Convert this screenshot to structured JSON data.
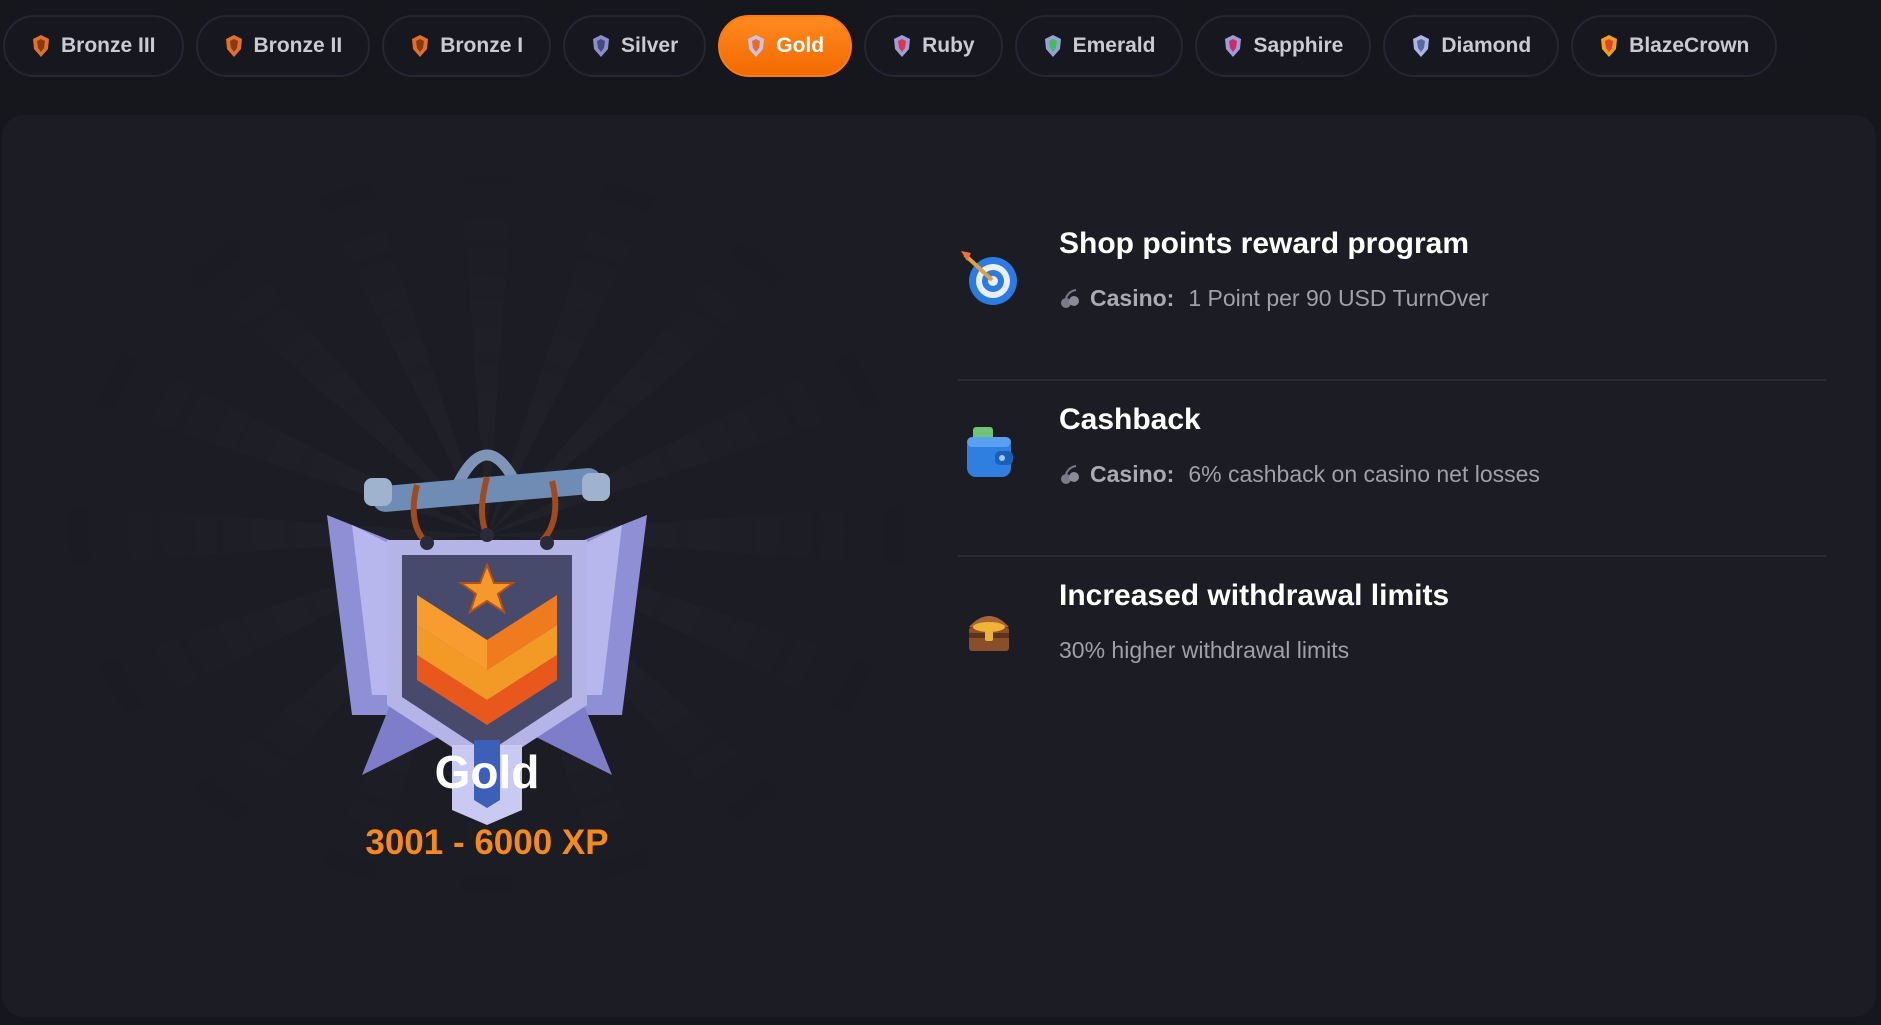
{
  "tiers": [
    {
      "label": "Bronze III",
      "color": "#e0702a",
      "active": false
    },
    {
      "label": "Bronze II",
      "color": "#e0702a",
      "active": false
    },
    {
      "label": "Bronze I",
      "color": "#e0702a",
      "active": false
    },
    {
      "label": "Silver",
      "color": "#8a8fc8",
      "active": false
    },
    {
      "label": "Gold",
      "color": "#f3b34a",
      "active": true
    },
    {
      "label": "Ruby",
      "color": "#e0344f",
      "active": false
    },
    {
      "label": "Emerald",
      "color": "#3fbf5a",
      "active": false
    },
    {
      "label": "Sapphire",
      "color": "#5f6ad8",
      "active": false
    },
    {
      "label": "Diamond",
      "color": "#a9b6e6",
      "active": false
    },
    {
      "label": "BlazeCrown",
      "color": "#f0a020",
      "active": false
    }
  ],
  "selected": {
    "name": "Gold",
    "xp_range": "3001 - 6000 XP"
  },
  "perks": [
    {
      "title": "Shop points reward program",
      "icon": "dart-target-icon",
      "label": "Casino:",
      "text": "1 Point per 90 USD TurnOver"
    },
    {
      "title": "Cashback",
      "icon": "wallet-icon",
      "label": "Casino:",
      "text": "6% cashback on casino net losses"
    },
    {
      "title": "Increased withdrawal limits",
      "icon": "treasure-chest-icon",
      "label": "",
      "text": "30% higher withdrawal limits"
    }
  ],
  "colors": {
    "accent": "#f26a00",
    "xp": "#f58a1c"
  }
}
